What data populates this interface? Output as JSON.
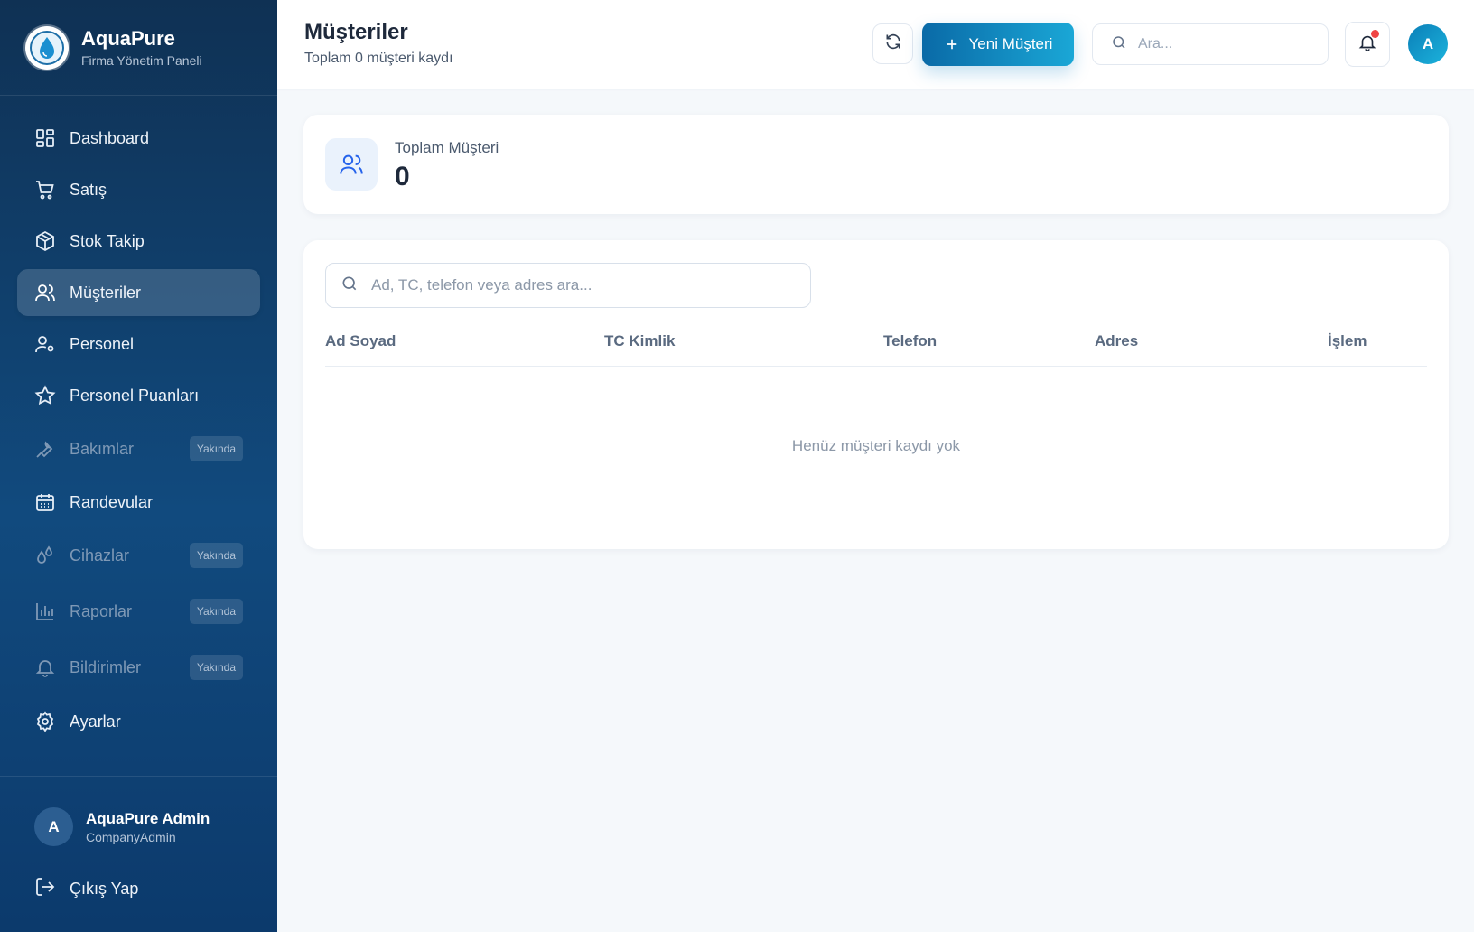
{
  "brand": {
    "title": "AquaPure",
    "subtitle": "Firma Yönetim Paneli"
  },
  "sidebar": {
    "items": [
      {
        "label": "Dashboard",
        "icon": "dashboard-icon"
      },
      {
        "label": "Satış",
        "icon": "cart-icon"
      },
      {
        "label": "Stok Takip",
        "icon": "box-icon"
      },
      {
        "label": "Müşteriler",
        "icon": "users-icon",
        "active": true
      },
      {
        "label": "Personel",
        "icon": "user-gear-icon"
      },
      {
        "label": "Personel Puanları",
        "icon": "star-icon"
      },
      {
        "label": "Bakımlar",
        "icon": "wrench-icon",
        "badge": "Yakında"
      },
      {
        "label": "Randevular",
        "icon": "calendar-icon"
      },
      {
        "label": "Cihazlar",
        "icon": "droplets-icon",
        "badge": "Yakında"
      },
      {
        "label": "Raporlar",
        "icon": "bar-chart-icon",
        "badge": "Yakında"
      },
      {
        "label": "Bildirimler",
        "icon": "bell-icon",
        "badge": "Yakında"
      },
      {
        "label": "Ayarlar",
        "icon": "gear-icon"
      }
    ],
    "user": {
      "initial": "A",
      "name": "AquaPure Admin",
      "role": "CompanyAdmin"
    },
    "logout_label": "Çıkış Yap"
  },
  "header": {
    "title": "Müşteriler",
    "subtitle": "Toplam 0 müşteri kaydı",
    "new_button_label": "Yeni Müşteri",
    "search_placeholder": "Ara...",
    "avatar_initial": "A"
  },
  "stats": {
    "label": "Toplam Müşteri",
    "value": "0"
  },
  "table": {
    "search_placeholder": "Ad, TC, telefon veya adres ara...",
    "columns": [
      "Ad Soyad",
      "TC Kimlik",
      "Telefon",
      "Adres",
      "İşlem"
    ],
    "empty_message": "Henüz müşteri kaydı yok"
  },
  "colors": {
    "accent": "#0a6aa7",
    "accent_light": "#1aa7d6",
    "sidebar_bg": "#114a7e",
    "notification": "#ef4444"
  }
}
